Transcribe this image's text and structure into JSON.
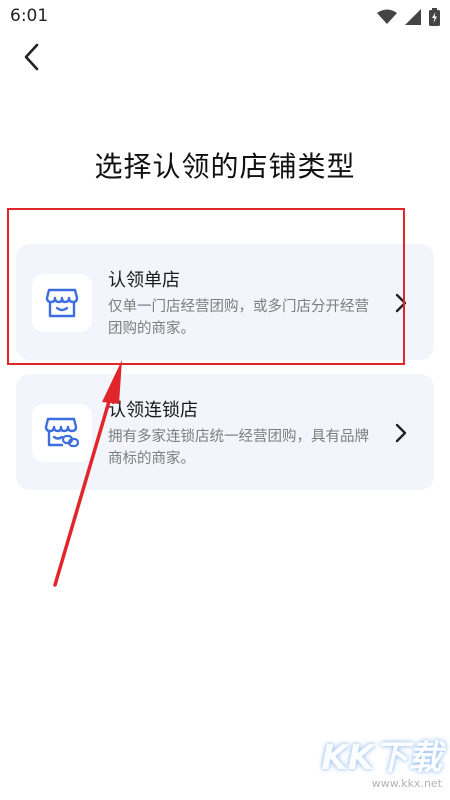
{
  "status_bar": {
    "time": "6:01"
  },
  "page": {
    "title": "选择认领的店铺类型"
  },
  "cards": [
    {
      "title": "认领单店",
      "desc": "仅单一门店经营团购，或多门店分开经营团购的商家。"
    },
    {
      "title": "认领连锁店",
      "desc": "拥有多家连锁店统一经营团购，具有品牌商标的商家。"
    }
  ],
  "watermark": {
    "logo": "KK下载",
    "url": "www.kkx.net"
  },
  "colors": {
    "icon_blue": "#3d6ee0",
    "highlight_red": "#e0262b",
    "card_bg": "#f2f5fb"
  }
}
